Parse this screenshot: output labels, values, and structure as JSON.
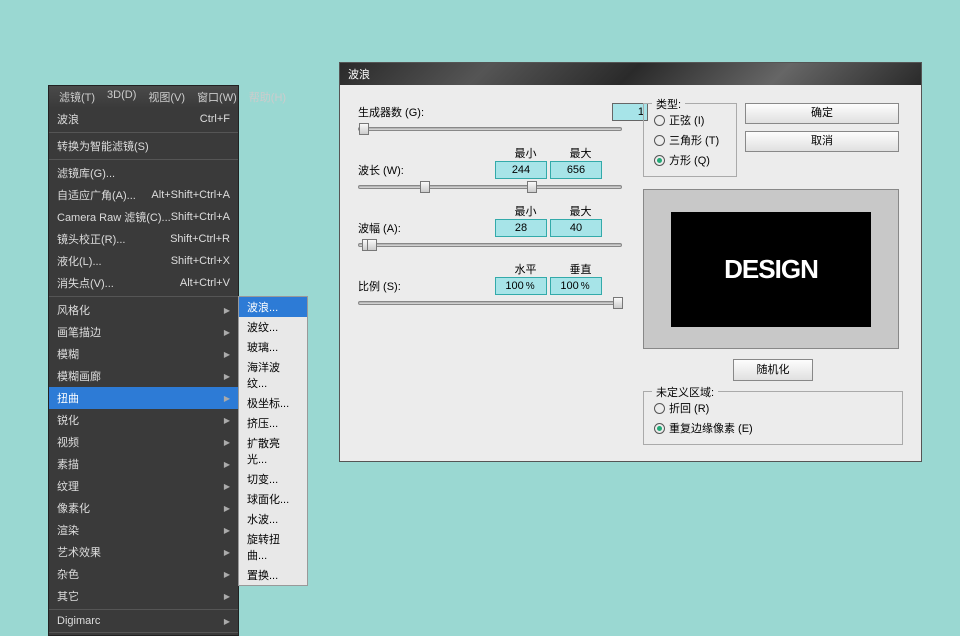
{
  "menubar": {
    "items": [
      "滤镜(T)",
      "3D(D)",
      "视图(V)",
      "窗口(W)",
      "帮助(H)"
    ]
  },
  "menu": {
    "recent": {
      "label": "波浪",
      "shortcut": "Ctrl+F"
    },
    "convert": "转换为智能滤镜(S)",
    "group1": [
      {
        "label": "滤镜库(G)...",
        "shortcut": ""
      },
      {
        "label": "自适应广角(A)...",
        "shortcut": "Alt+Shift+Ctrl+A"
      },
      {
        "label": "Camera Raw 滤镜(C)...",
        "shortcut": "Shift+Ctrl+A"
      },
      {
        "label": "镜头校正(R)...",
        "shortcut": "Shift+Ctrl+R"
      },
      {
        "label": "液化(L)...",
        "shortcut": "Shift+Ctrl+X"
      },
      {
        "label": "消失点(V)...",
        "shortcut": "Alt+Ctrl+V"
      }
    ],
    "group2": [
      "风格化",
      "画笔描边",
      "模糊",
      "模糊画廊",
      "扭曲",
      "锐化",
      "视频",
      "素描",
      "纹理",
      "像素化",
      "渲染",
      "艺术效果",
      "杂色",
      "其它"
    ],
    "digimarc": "Digimarc",
    "selected": "扭曲"
  },
  "submenu": {
    "items": [
      "波浪...",
      "波纹...",
      "玻璃...",
      "海洋波纹...",
      "极坐标...",
      "挤压...",
      "扩散亮光...",
      "切变...",
      "球面化...",
      "水波...",
      "旋转扭曲...",
      "置换..."
    ],
    "selected": "波浪..."
  },
  "dialog": {
    "title": "波浪",
    "generators": {
      "label": "生成器数 (G):",
      "value": "1"
    },
    "wavelength": {
      "label": "波长 (W):",
      "hdr_min": "最小",
      "hdr_max": "最大",
      "min": "244",
      "max": "656"
    },
    "amplitude": {
      "label": "波幅 (A):",
      "hdr_min": "最小",
      "hdr_max": "最大",
      "min": "28",
      "max": "40"
    },
    "scale": {
      "label": "比例 (S):",
      "hdr_h": "水平",
      "hdr_v": "垂直",
      "h": "100",
      "v": "100",
      "pct": "%"
    },
    "type": {
      "legend": "类型:",
      "opts": [
        "正弦 (I)",
        "三角形 (T)",
        "方形 (Q)"
      ],
      "checked": 2
    },
    "undef": {
      "legend": "未定义区域:",
      "opts": [
        "折回 (R)",
        "重复边缘像素 (E)"
      ],
      "checked": 1
    },
    "buttons": {
      "ok": "确定",
      "cancel": "取消",
      "random": "随机化"
    },
    "preview_text": "DESIGN"
  }
}
